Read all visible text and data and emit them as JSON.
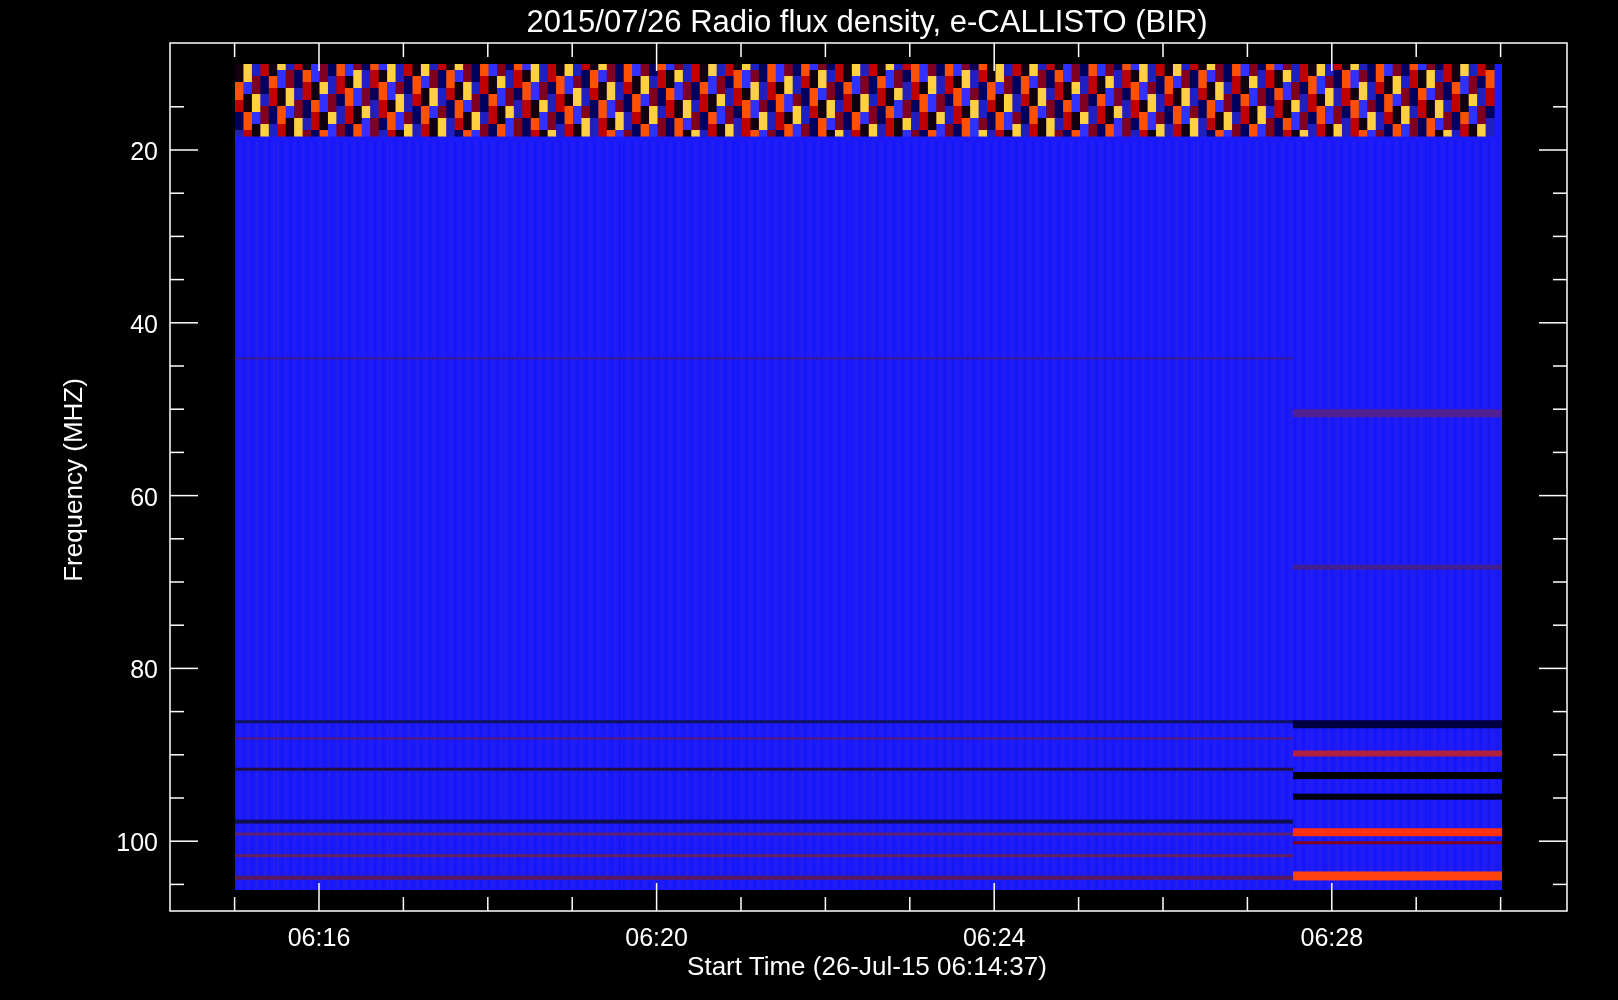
{
  "figure": {
    "title": "2015/07/26  Radio flux density, e-CALLISTO (BIR)",
    "y_axis": {
      "label": "Frequency (MHZ)",
      "ticks": [
        "20",
        "40",
        "60",
        "80",
        "100"
      ]
    },
    "x_axis": {
      "label": "Start Time (26-Jul-15 06:14:37)",
      "ticks": [
        "06:16",
        "06:20",
        "06:24",
        "06:28"
      ]
    }
  }
}
